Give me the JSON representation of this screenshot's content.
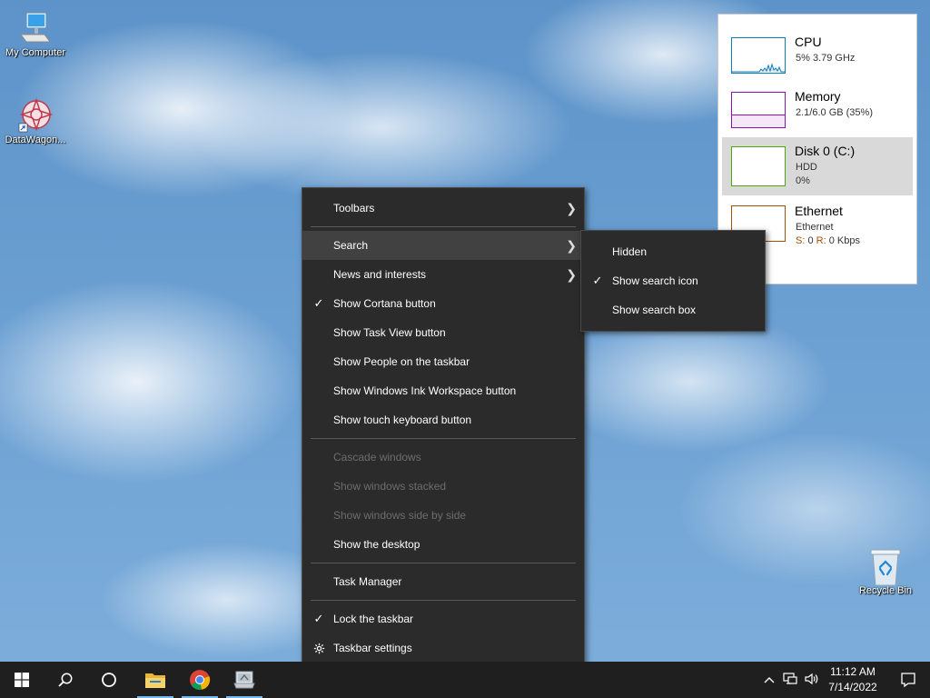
{
  "desktop": {
    "icons": [
      {
        "label": "My Computer"
      },
      {
        "label": "DataWagon..."
      },
      {
        "label": "Recycle Bin"
      }
    ]
  },
  "context_menu": {
    "items": [
      {
        "label": "Toolbars",
        "submenu": true
      },
      {
        "label": "Search",
        "submenu": true,
        "highlighted": true
      },
      {
        "label": "News and interests",
        "submenu": true
      },
      {
        "label": "Show Cortana button",
        "checked": true
      },
      {
        "label": "Show Task View button"
      },
      {
        "label": "Show People on the taskbar"
      },
      {
        "label": "Show Windows Ink Workspace button"
      },
      {
        "label": "Show touch keyboard button"
      },
      {
        "label": "Cascade windows",
        "disabled": true
      },
      {
        "label": "Show windows stacked",
        "disabled": true
      },
      {
        "label": "Show windows side by side",
        "disabled": true
      },
      {
        "label": "Show the desktop"
      },
      {
        "label": "Task Manager"
      },
      {
        "label": "Lock the taskbar",
        "checked": true
      },
      {
        "label": "Taskbar settings",
        "icon": "gear-icon"
      }
    ]
  },
  "search_submenu": {
    "items": [
      {
        "label": "Hidden"
      },
      {
        "label": "Show search icon",
        "checked": true
      },
      {
        "label": "Show search box"
      }
    ]
  },
  "performance": {
    "cpu": {
      "title": "CPU",
      "detail": "5% 3.79 GHz",
      "color": "#117dbb"
    },
    "memory": {
      "title": "Memory",
      "detail": "2.1/6.0 GB (35%)",
      "color": "#8b12ae"
    },
    "disk": {
      "title": "Disk 0 (C:)",
      "type": "HDD",
      "detail": "0%",
      "color": "#4da60c"
    },
    "ethernet": {
      "title": "Ethernet",
      "name": "Ethernet",
      "send_label": "S:",
      "send": "0",
      "recv_label": "R:",
      "recv": "0 Kbps",
      "color": "#a74f01"
    }
  },
  "taskbar": {
    "icons": [
      "start-icon",
      "search-icon",
      "cortana-icon",
      "file-explorer-icon",
      "chrome-icon",
      "app-icon"
    ],
    "clock": {
      "time": "11:12 AM",
      "date": "7/14/2022"
    }
  }
}
